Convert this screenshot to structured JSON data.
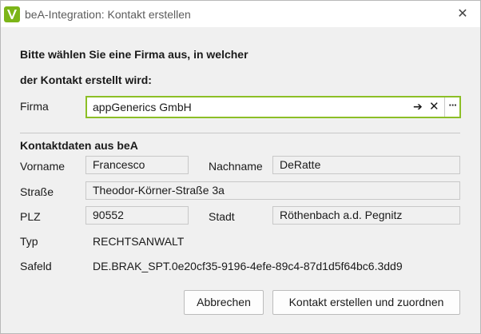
{
  "window": {
    "title": "beA-Integration: Kontakt erstellen",
    "close_glyph": "✕",
    "app_icon": "v-logo-icon",
    "accent_color": "#8cbf26"
  },
  "prompt": {
    "line1": "Bitte wählen Sie eine Firma aus, in welcher",
    "line2": "der Kontakt erstellt wird:"
  },
  "firma": {
    "label": "Firma",
    "value": "appGenerics GmbH",
    "navigate_glyph": "➔",
    "clear_glyph": "✕",
    "more_glyph": "···"
  },
  "contact": {
    "section_title": "Kontaktdaten aus beA",
    "vorname_label": "Vorname",
    "vorname": "Francesco",
    "nachname_label": "Nachname",
    "nachname": "DeRatte",
    "strasse_label": "Straße",
    "strasse": "Theodor-Körner-Straße 3a",
    "plz_label": "PLZ",
    "plz": "90552",
    "stadt_label": "Stadt",
    "stadt": "Röthenbach a.d. Pegnitz",
    "typ_label": "Typ",
    "typ": "RECHTSANWALT",
    "safeld_label": "Safeld",
    "safeld": "DE.BRAK_SPT.0e20cf35-9196-4efe-89c4-87d1d5f64bc6.3dd9"
  },
  "buttons": {
    "cancel": "Abbrechen",
    "create": "Kontakt erstellen und zuordnen"
  }
}
